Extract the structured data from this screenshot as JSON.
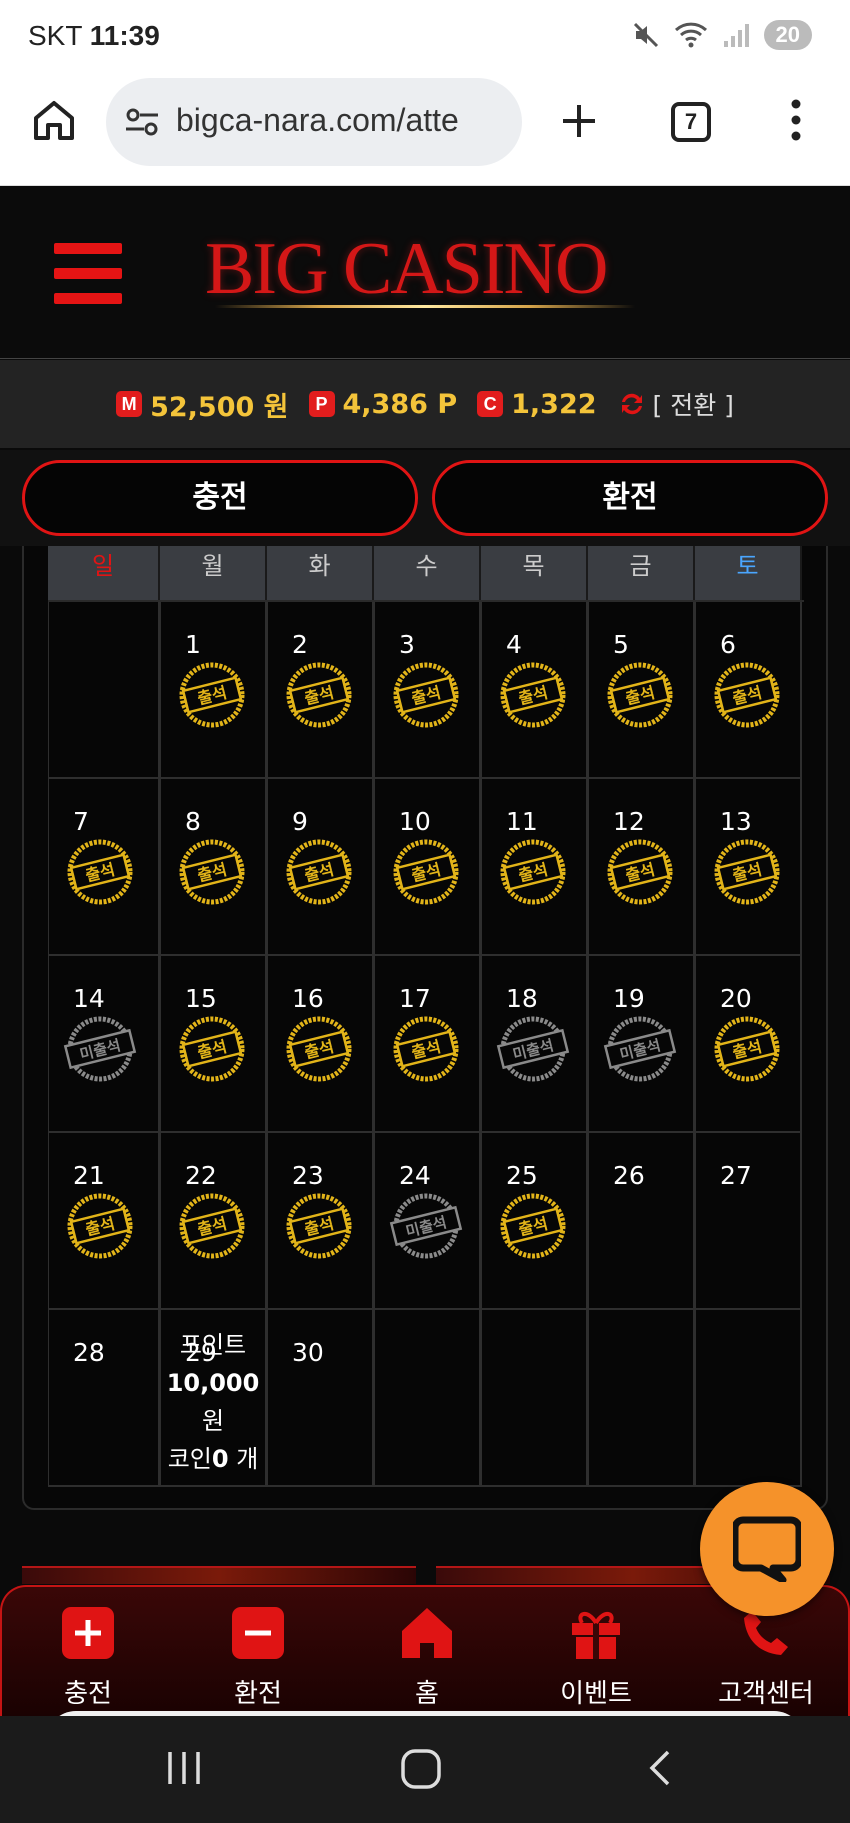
{
  "status": {
    "carrier": "SKT",
    "time": "11:39",
    "battery": "20"
  },
  "browser": {
    "url": "bigca-nara.com/atte",
    "tab_count": "7"
  },
  "site": {
    "logo": "BIG CASINO"
  },
  "balance": {
    "money": {
      "badge": "M",
      "value": "52,500 원"
    },
    "point": {
      "badge": "P",
      "value": "4,386 P"
    },
    "coin": {
      "badge": "C",
      "value": "1,322"
    },
    "convert_label": "[ 전환 ]"
  },
  "actions": {
    "charge": "충전",
    "exchange": "환전"
  },
  "calendar": {
    "weekdays": [
      "일",
      "월",
      "화",
      "수",
      "목",
      "금",
      "토"
    ],
    "stamp_attend": "출석",
    "stamp_absent": "미출석",
    "days": [
      {
        "day": "",
        "status": ""
      },
      {
        "day": "1",
        "status": "attend"
      },
      {
        "day": "2",
        "status": "attend"
      },
      {
        "day": "3",
        "status": "attend"
      },
      {
        "day": "4",
        "status": "attend"
      },
      {
        "day": "5",
        "status": "attend"
      },
      {
        "day": "6",
        "status": "attend"
      },
      {
        "day": "7",
        "status": "attend"
      },
      {
        "day": "8",
        "status": "attend"
      },
      {
        "day": "9",
        "status": "attend"
      },
      {
        "day": "10",
        "status": "attend"
      },
      {
        "day": "11",
        "status": "attend"
      },
      {
        "day": "12",
        "status": "attend"
      },
      {
        "day": "13",
        "status": "attend"
      },
      {
        "day": "14",
        "status": "absent"
      },
      {
        "day": "15",
        "status": "attend"
      },
      {
        "day": "16",
        "status": "attend"
      },
      {
        "day": "17",
        "status": "attend"
      },
      {
        "day": "18",
        "status": "absent"
      },
      {
        "day": "19",
        "status": "absent"
      },
      {
        "day": "20",
        "status": "attend"
      },
      {
        "day": "21",
        "status": "attend"
      },
      {
        "day": "22",
        "status": "attend"
      },
      {
        "day": "23",
        "status": "attend"
      },
      {
        "day": "24",
        "status": "absent"
      },
      {
        "day": "25",
        "status": "attend"
      },
      {
        "day": "26",
        "status": ""
      },
      {
        "day": "27",
        "status": ""
      },
      {
        "day": "28",
        "status": ""
      },
      {
        "day": "29",
        "status": "",
        "note": {
          "line1": "포인트",
          "line2": "10,000",
          "line3": "원",
          "line4a": "코인",
          "line4b": "0",
          "line4c": " 개"
        }
      },
      {
        "day": "30",
        "status": ""
      },
      {
        "day": "",
        "status": ""
      },
      {
        "day": "",
        "status": ""
      },
      {
        "day": "",
        "status": ""
      },
      {
        "day": "",
        "status": ""
      }
    ]
  },
  "bottom_nav": [
    {
      "label": "충전",
      "icon": "plus-icon"
    },
    {
      "label": "환전",
      "icon": "minus-icon"
    },
    {
      "label": "홈",
      "icon": "home-icon"
    },
    {
      "label": "이벤트",
      "icon": "gift-icon"
    },
    {
      "label": "고객센터",
      "icon": "phone-icon"
    }
  ],
  "colors": {
    "brand_red": "#e01414",
    "gold": "#f4c43a",
    "chat_orange": "#f5922a"
  }
}
